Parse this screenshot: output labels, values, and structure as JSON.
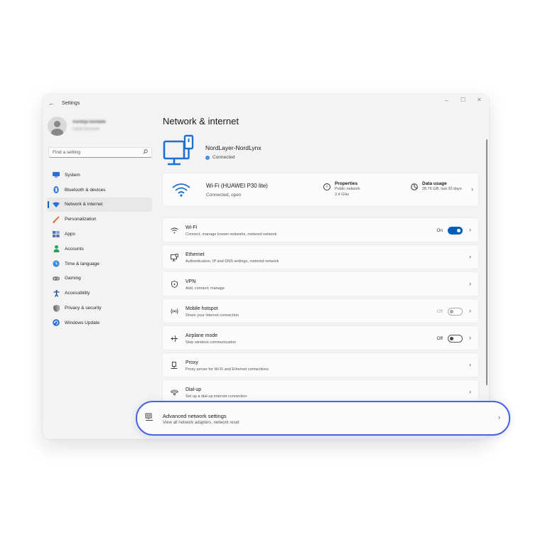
{
  "window": {
    "title": "Settings",
    "back": "←",
    "minimize": "–",
    "maximize": "☐",
    "close": "✕"
  },
  "profile": {
    "name": "Aurelija Ekstaite",
    "email": "Local Account"
  },
  "search": {
    "placeholder": "Find a setting"
  },
  "sidebar": {
    "items": [
      {
        "label": "System",
        "icon": "monitor-icon",
        "color": "#2b6fd6"
      },
      {
        "label": "Bluetooth & devices",
        "icon": "bluetooth-icon",
        "color": "#2b6fd6"
      },
      {
        "label": "Network & internet",
        "icon": "wifi-diamond-icon",
        "color": "#2b6fd6",
        "active": true
      },
      {
        "label": "Personalization",
        "icon": "brush-icon",
        "color": "#e0763a"
      },
      {
        "label": "Apps",
        "icon": "apps-icon",
        "color": "#5a6ea8"
      },
      {
        "label": "Accounts",
        "icon": "person-icon",
        "color": "#2aa05a"
      },
      {
        "label": "Time & language",
        "icon": "globe-clock-icon",
        "color": "#3a8fd8"
      },
      {
        "label": "Gaming",
        "icon": "gamepad-icon",
        "color": "#808080"
      },
      {
        "label": "Accessibility",
        "icon": "accessibility-icon",
        "color": "#1f4c8f"
      },
      {
        "label": "Privacy & security",
        "icon": "shield-icon",
        "color": "#777777"
      },
      {
        "label": "Windows Update",
        "icon": "update-icon",
        "color": "#2b6fd6"
      }
    ]
  },
  "main": {
    "heading": "Network & internet",
    "connection": {
      "name": "NordLayer-NordLynx",
      "status": "Connected"
    },
    "wifi": {
      "name": "Wi-Fi (HUAWEI P30 lite)",
      "status": "Connected, open",
      "properties": {
        "title": "Properties",
        "line1": "Public network",
        "line2": "2.4 GHz"
      },
      "data_usage": {
        "title": "Data usage",
        "value": "28.76 GB, last 30 days"
      }
    },
    "rows": [
      {
        "title": "Wi-Fi",
        "desc": "Connect, manage known networks, metered network",
        "toggle": "On"
      },
      {
        "title": "Ethernet",
        "desc": "Authentication, IP and DNS settings, metered network"
      },
      {
        "title": "VPN",
        "desc": "Add, connect, manage"
      },
      {
        "title": "Mobile hotspot",
        "desc": "Share your internet connection",
        "toggle": "Off"
      },
      {
        "title": "Airplane mode",
        "desc": "Stop wireless communication",
        "toggle": "Off"
      },
      {
        "title": "Proxy",
        "desc": "Proxy server for Wi-Fi and Ethernet connections"
      },
      {
        "title": "Dial-up",
        "desc": "Set up a dial-up internet connection"
      }
    ],
    "advanced": {
      "title": "Advanced network settings",
      "desc": "View all network adapters, network reset"
    }
  },
  "colors": {
    "accent": "#005fb8",
    "highlight": "#4a63e0"
  }
}
